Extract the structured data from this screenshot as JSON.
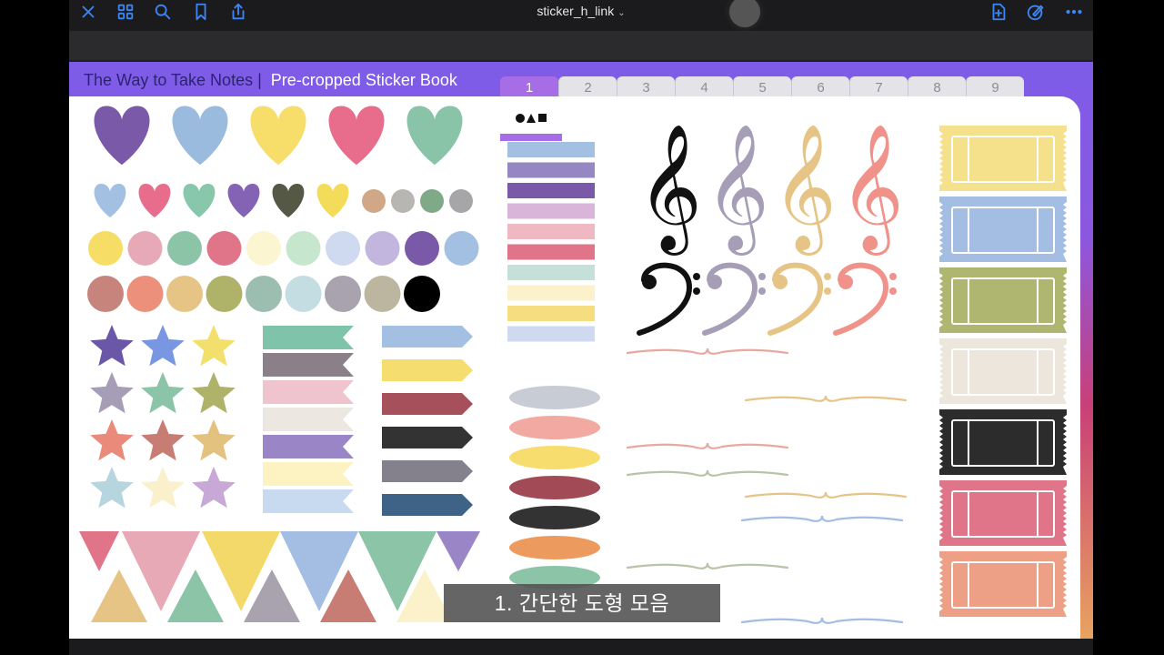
{
  "toolbar": {
    "document_title": "sticker_h_link",
    "icons": [
      "close-icon",
      "grid-icon",
      "search-icon",
      "bookmark-icon",
      "share-icon",
      "add-page-icon",
      "pencil-circle-icon",
      "more-icon"
    ]
  },
  "book": {
    "title": "The Way to Take Notes |",
    "subtitle": "Pre-cropped Sticker Book",
    "tabs": [
      "1",
      "2",
      "3",
      "4",
      "5",
      "6",
      "7",
      "8",
      "9"
    ],
    "active_tab": "1"
  },
  "caption": "1. 간단한 도형 모음",
  "colors": {
    "accent": "#3b86f7",
    "page_gradient_top": "#7d5ce8",
    "page_gradient_bottom": "#e8a35f",
    "active_tab": "#a66de6"
  },
  "stickers": {
    "big_hearts": [
      "#7a5aa8",
      "#9bbbde",
      "#f7de6a",
      "#e86d8c",
      "#89c4a9"
    ],
    "small_hearts": [
      "#a3c0e3",
      "#e86d8c",
      "#88c7ab",
      "#8463b5",
      "#545845",
      "#f2dc5a"
    ],
    "small_dots": [
      "#d1a887",
      "#b8b6b3",
      "#7fa987",
      "#a6a6a9"
    ],
    "circles_row1": [
      "#f6de66",
      "#e8a9b6",
      "#8cc4a8",
      "#e07488",
      "#fbf5d2",
      "#c6e6cd",
      "#cfdaf0",
      "#c3b6de",
      "#7a5aa8",
      "#a3c0e3"
    ],
    "circles_row2": [
      "#c7847c",
      "#ec907b",
      "#e5c486",
      "#afb36a",
      "#9bbeb0",
      "#c4dde3",
      "#a8a3ae",
      "#bcb6a0",
      "#000000"
    ],
    "stars": [
      "#6b57a8",
      "#7896e2",
      "#f3e06c",
      "#a59eb6",
      "#8cc4a8",
      "#afb36a",
      "#e98a7b",
      "#c87d74",
      "#e3c27f",
      "#b6d5de",
      "#faf1cc",
      "#c7a8d6"
    ],
    "flags": [
      "#7fc4aa",
      "#8b8088",
      "#f0c4ce",
      "#ece7e0",
      "#9a86c6",
      "#fdf2c2",
      "#c8daf0"
    ],
    "arrows": [
      "#a3c0e3",
      "#f6dd6f",
      "#a5505a",
      "#333333",
      "#84808c",
      "#3f6386"
    ],
    "stripes": [
      "#a3c0e3",
      "#9588c2",
      "#7a5aa8",
      "#d9b6d9",
      "#f0b8c2",
      "#e07488",
      "#c5e0d8",
      "#fbf2cc",
      "#f6de80",
      "#cfdaf0"
    ],
    "ovals": [
      "#c8ccd4",
      "#f1a9a2",
      "#f7dd6d",
      "#a24a55",
      "#333333",
      "#ec9a5d",
      "#8cc4a8"
    ],
    "clef_colors": [
      "#111111",
      "#a59eb6",
      "#e5c486",
      "#f0918a"
    ],
    "tickets": [
      "#f5e08c",
      "#a3bde3",
      "#afb66f",
      "#ece6dd",
      "#2c2c2c",
      "#e07488",
      "#eea086"
    ],
    "pennants_top": [
      "#e07488",
      "#e8a9b6",
      "#f3d96a",
      "#a3bde3",
      "#8cc4a8",
      "#9a86c6"
    ],
    "pennants_bottom": [
      "#e5c486",
      "#8cc4a8",
      "#a8a3ae",
      "#c87d74",
      "#fbf2cc"
    ],
    "dividers": [
      "#e8a9a0",
      "#e5c486",
      "#e8a9a0",
      "#b8c4a8",
      "#e5c486",
      "#a3bde3",
      "#b8c4a8",
      "#a3bde3"
    ]
  }
}
